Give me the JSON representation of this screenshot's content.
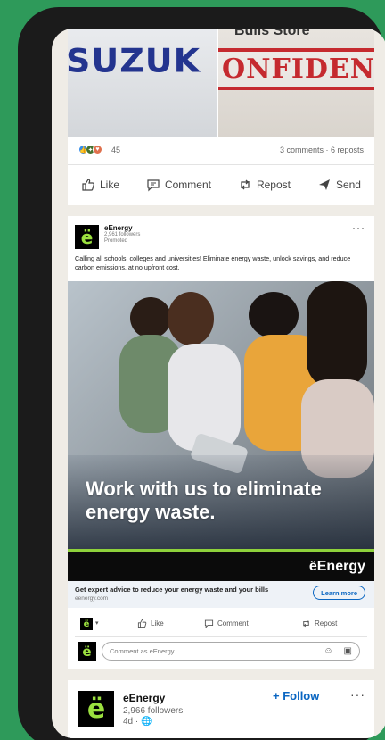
{
  "post1": {
    "image_left_text": "SUZUK",
    "image_right_top": "Bulls Store",
    "image_right_stamp": "ONFIDENTIAL",
    "reaction_count": "45",
    "stats": "3 comments · 6 reposts",
    "actions": {
      "like": "Like",
      "comment": "Comment",
      "repost": "Repost",
      "send": "Send"
    }
  },
  "ad": {
    "logo_glyph": "ë",
    "name": "eEnergy",
    "followers": "2,961 followers",
    "promoted": "Promoted",
    "more": "···",
    "body": "Calling all schools, colleges and universities! Eliminate energy waste, unlock savings, and reduce carbon emissions, at no upfront cost.",
    "headline": "Work with us to eliminate energy waste.",
    "brand": "ëEnergy",
    "cta_title": "Get expert advice to reduce your energy waste and your bills",
    "cta_domain": "eenergy.com",
    "learn_more": "Learn more",
    "actions": {
      "like": "Like",
      "comment": "Comment",
      "repost": "Repost"
    },
    "comment_placeholder": "Comment as eEnergy..."
  },
  "post3": {
    "logo_glyph": "ë",
    "name": "eEnergy",
    "followers": "2,966 followers",
    "time": "4d · ",
    "follow": "+ Follow",
    "more": "···"
  },
  "colors": {
    "background": "#2e9a5a",
    "brand_green": "#8ed13b",
    "link_blue": "#0a66c2"
  }
}
